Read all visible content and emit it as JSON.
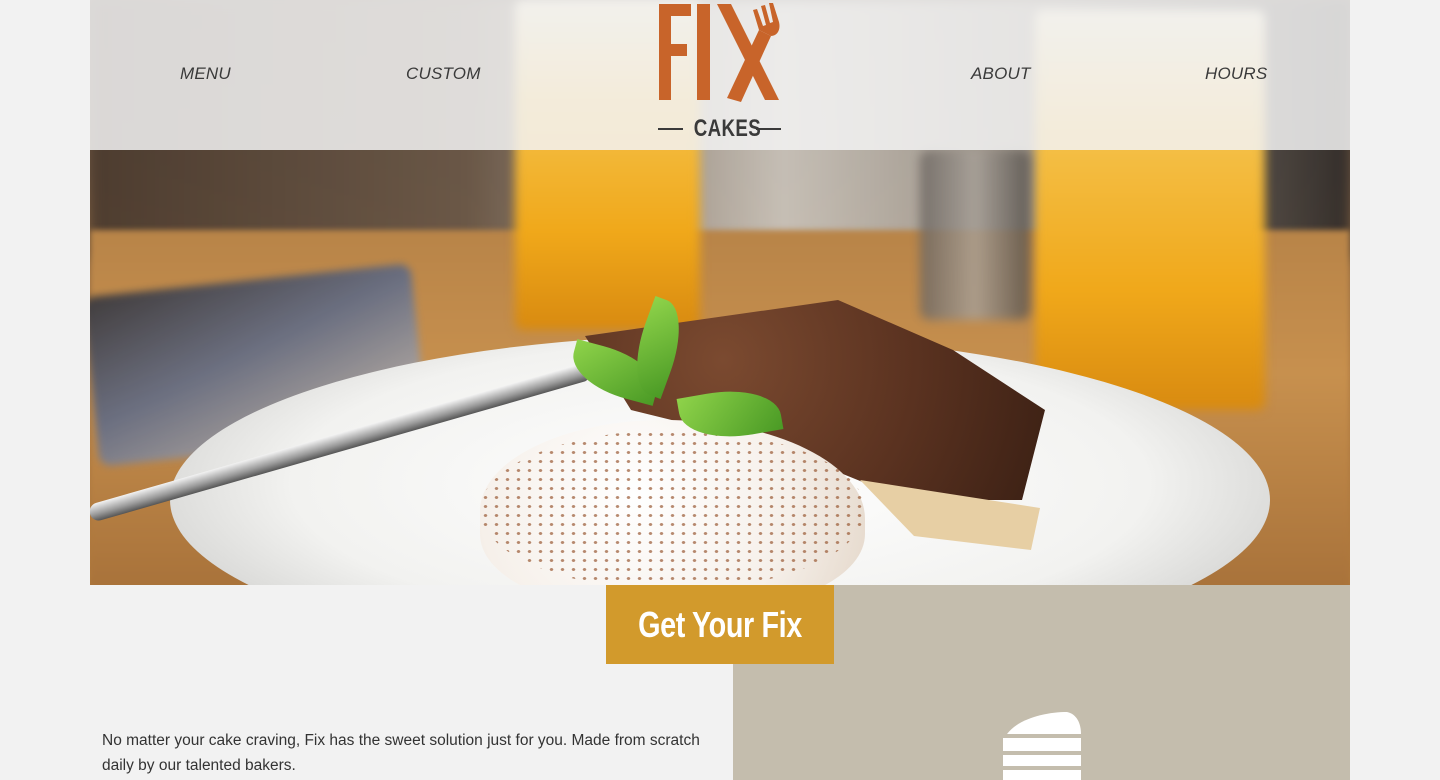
{
  "nav": {
    "menu_label": "MENU",
    "custom_label": "CUSTOM",
    "about_label": "ABOUT",
    "hours_label": "HOURS"
  },
  "logo": {
    "wordmark": "FIX",
    "subtitle": "CAKES",
    "icon": "fork-knife-icon"
  },
  "hero": {
    "image": "chocolate-cake-slice-photo"
  },
  "cta": {
    "label": "Get Your Fix"
  },
  "intro": {
    "text": "No matter your cake craving, Fix has the sweet solution just for you. Made from scratch daily by our talented bakers."
  },
  "feature": {
    "icon": "cake-slice-icon"
  },
  "colors": {
    "background": "#f2f2f2",
    "brand_orange": "#c8642a",
    "cta_gold": "#d29a2c",
    "panel_taupe": "#c4bdad",
    "text_dark": "#333333"
  }
}
